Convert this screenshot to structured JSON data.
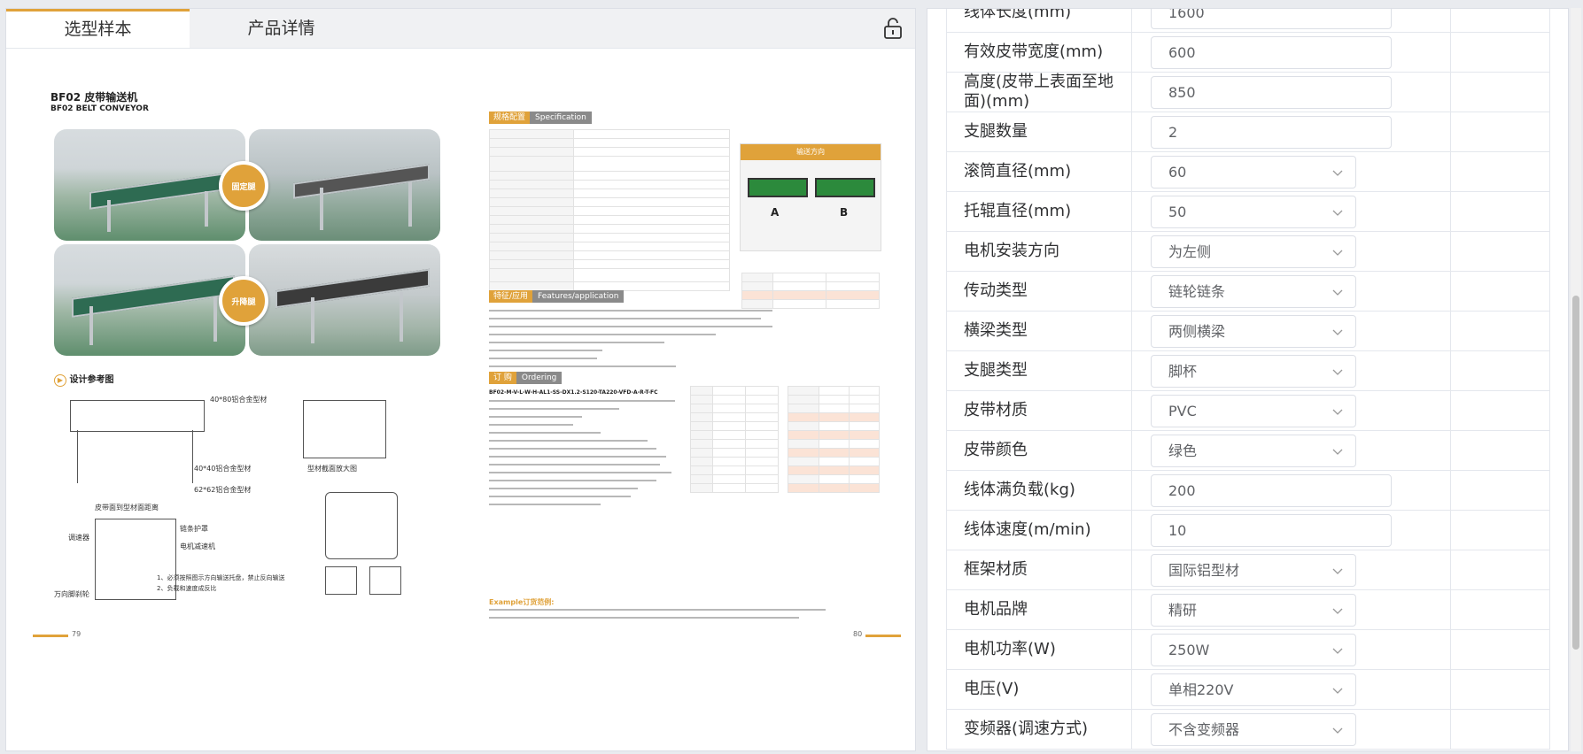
{
  "tabs": [
    {
      "label": "选型样本"
    },
    {
      "label": "产品详情"
    }
  ],
  "catalog": {
    "title_cn": "BF02  皮带输送机",
    "title_en": "BF02     BELT CONVEYOR",
    "badge_fixed": "固定腿",
    "badge_lift": "升降腿",
    "spec_head": "规格配置",
    "spec_head_en": "Specification",
    "features_head": "特征/应用",
    "features_head_en": "Features/application",
    "order_head": "订  购",
    "order_head_en": "Ordering",
    "order_code": "BF02-M-V-L-W-H-AL1-SS-DX1.2-S120-TA220-VFD-A-R-T-FC",
    "direction_title": "输送方向",
    "direction_a": "A",
    "direction_b": "B",
    "design_ref": "设计参考图",
    "example": "Example订货范例:",
    "page_left": "79",
    "page_right": "80",
    "drawing_labels": {
      "profile1": "40*80铝合金型材",
      "profile2": "40*40铝合金型材",
      "profile3": "62*62铝合金型材",
      "section": "型材截面放大图",
      "belt_dist": "皮带面到型材面距离",
      "speed": "调速器",
      "chain_guard": "链条护罩",
      "motor": "电机减速机",
      "caster": "万向脚刹轮",
      "note1": "1、必须按照图示方向输送托盘，禁止反向输送",
      "note2": "2、负载和速度成反比"
    }
  },
  "form": {
    "rows": [
      {
        "label": "线体长度(mm)",
        "type": "input",
        "value": "1600"
      },
      {
        "label": "有效皮带宽度(mm)",
        "type": "input",
        "value": "600"
      },
      {
        "label": "高度(皮带上表面至地面)(mm)",
        "type": "input",
        "value": "850"
      },
      {
        "label": "支腿数量",
        "type": "input",
        "value": "2"
      },
      {
        "label": "滚筒直径(mm)",
        "type": "select",
        "value": "60"
      },
      {
        "label": "托辊直径(mm)",
        "type": "select",
        "value": "50"
      },
      {
        "label": "电机安装方向",
        "type": "select",
        "value": "为左侧"
      },
      {
        "label": "传动类型",
        "type": "select",
        "value": "链轮链条"
      },
      {
        "label": "横梁类型",
        "type": "select",
        "value": "两侧横梁"
      },
      {
        "label": "支腿类型",
        "type": "select",
        "value": "脚杯"
      },
      {
        "label": "皮带材质",
        "type": "select",
        "value": "PVC"
      },
      {
        "label": "皮带颜色",
        "type": "select",
        "value": "绿色"
      },
      {
        "label": "线体满负载(kg)",
        "type": "input",
        "value": "200"
      },
      {
        "label": "线体速度(m/min)",
        "type": "input",
        "value": "10"
      },
      {
        "label": "框架材质",
        "type": "select",
        "value": "国际铝型材"
      },
      {
        "label": "电机品牌",
        "type": "select",
        "value": "精研"
      },
      {
        "label": "电机功率(W)",
        "type": "select",
        "value": "250W"
      },
      {
        "label": "电压(V)",
        "type": "select",
        "value": "单相220V"
      },
      {
        "label": "变频器(调速方式)",
        "type": "select",
        "value": "不含变频器"
      }
    ]
  },
  "colors": {
    "accent": "#e0a23a",
    "belt_green": "#2e6b52",
    "border": "#dcdfe6"
  }
}
